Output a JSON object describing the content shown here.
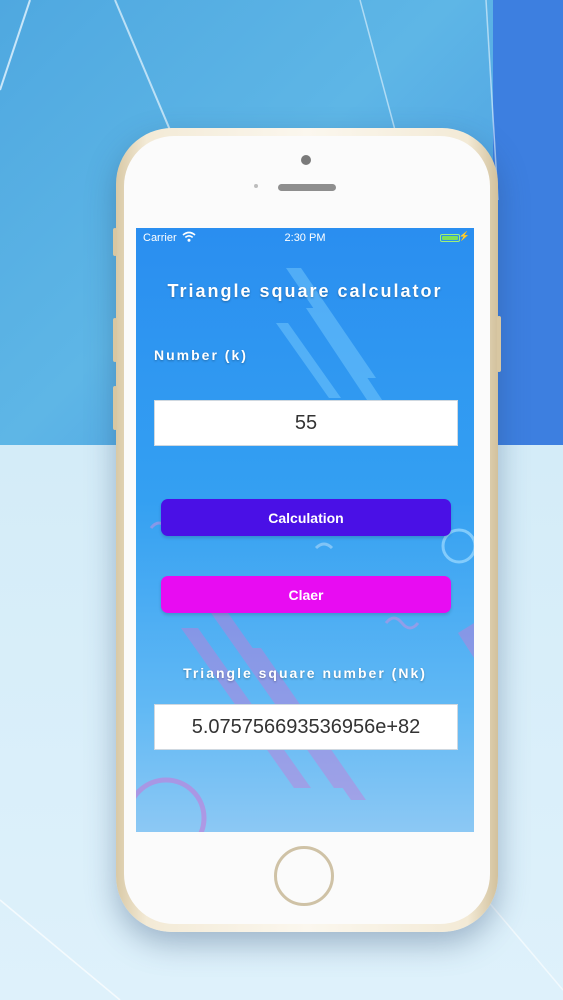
{
  "status_bar": {
    "carrier": "Carrier",
    "time": "2:30 PM"
  },
  "app": {
    "title": "Triangle square calculator",
    "input_label": "Number (k)",
    "input_value": "55",
    "calculate_button": "Calculation",
    "clear_button": "Claer",
    "result_label": "Triangle square number (Nk)",
    "result_value": "5.075756693536956e+82"
  },
  "colors": {
    "calculate_button": "#4a10e6",
    "clear_button": "#e80cf2",
    "screen_top": "#2a8ef0",
    "screen_bottom": "#8cc8f4"
  },
  "icons": {
    "wifi": "wifi-icon",
    "battery": "battery-icon",
    "charging": "charging-bolt-icon"
  }
}
